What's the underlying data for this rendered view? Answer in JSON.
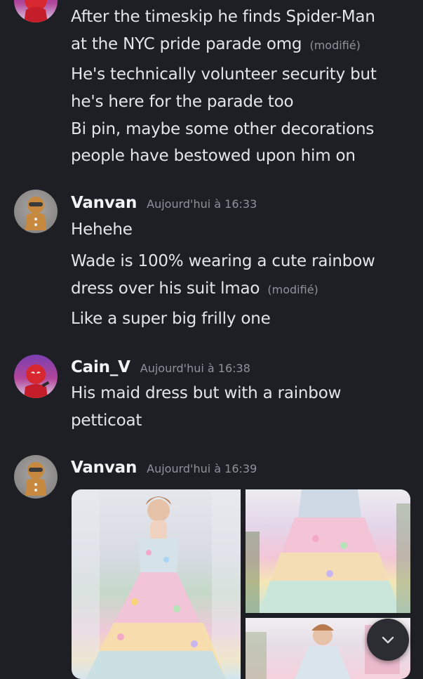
{
  "messages": [
    {
      "id": "cont",
      "author": "",
      "lines": [
        {
          "text": "After the timeskip he finds Spider-Man",
          "edited": ""
        },
        {
          "text": "at the NYC pride parade omg",
          "edited": "(modifié)"
        },
        {
          "text": "He's technically volunteer security but",
          "edited": ""
        },
        {
          "text": "he's here for the parade too",
          "edited": ""
        },
        {
          "text": "Bi pin, maybe some other decorations",
          "edited": ""
        },
        {
          "text": "people have bestowed upon him on",
          "edited": ""
        }
      ]
    },
    {
      "id": "v1",
      "author": "Vanvan",
      "timestamp": "Aujourd'hui à 16:33",
      "lines": [
        {
          "text": "Hehehe",
          "edited": ""
        },
        {
          "text": "Wade is 100% wearing a cute rainbow",
          "edited": ""
        },
        {
          "text": "dress over his suit lmao",
          "edited": "(modifié)"
        },
        {
          "text": "Like a super big frilly one",
          "edited": ""
        }
      ]
    },
    {
      "id": "c1",
      "author": "Cain_V",
      "timestamp": "Aujourd'hui à 16:38",
      "lines": [
        {
          "text": "His maid dress but with a rainbow",
          "edited": ""
        },
        {
          "text": "petticoat",
          "edited": ""
        }
      ]
    },
    {
      "id": "v2",
      "author": "Vanvan",
      "timestamp": "Aujourd'hui à 16:39",
      "attachments": [
        "rainbow-gown-photo-1",
        "rainbow-gown-photo-2",
        "rainbow-gown-photo-3"
      ]
    }
  ],
  "icons": {
    "scroll": "chevron-down-icon"
  },
  "colors": {
    "background": "#1e1f24",
    "author": "#f2f3f5",
    "meta": "#8f929b",
    "body": "#e3e5ea"
  }
}
